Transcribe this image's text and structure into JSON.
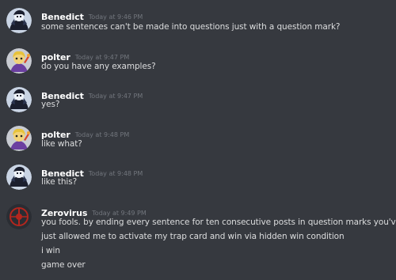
{
  "messages": [
    {
      "username": "Benedict",
      "timestamp": "Today at 9:46 PM",
      "avatar_icon": "benedict-avatar",
      "lines": [
        "some sentences can't be made into questions just with a question mark?"
      ]
    },
    {
      "username": "polter",
      "timestamp": "Today at 9:47 PM",
      "avatar_icon": "polter-avatar",
      "lines": [
        "do you have any examples?"
      ]
    },
    {
      "username": "Benedict",
      "timestamp": "Today at 9:47 PM",
      "avatar_icon": "benedict-avatar",
      "lines": [
        "yes?"
      ]
    },
    {
      "username": "polter",
      "timestamp": "Today at 9:48 PM",
      "avatar_icon": "polter-avatar",
      "lines": [
        "like what?"
      ]
    },
    {
      "username": "Benedict",
      "timestamp": "Today at 9:48 PM",
      "avatar_icon": "benedict-avatar",
      "lines": [
        "like this?"
      ]
    },
    {
      "username": "Zerovirus",
      "timestamp": "Today at 9:49 PM",
      "avatar_icon": "zerovirus-avatar",
      "lines": [
        "you fools. by ending every sentence for ten consecutive posts in question marks you've",
        "just allowed me to activate my trap card and win via hidden win condition",
        "i win",
        "game over"
      ]
    }
  ],
  "colors": {
    "background": "#36393f",
    "username": "#ffffff",
    "timestamp": "#72767d",
    "message_text": "#dcddde"
  }
}
